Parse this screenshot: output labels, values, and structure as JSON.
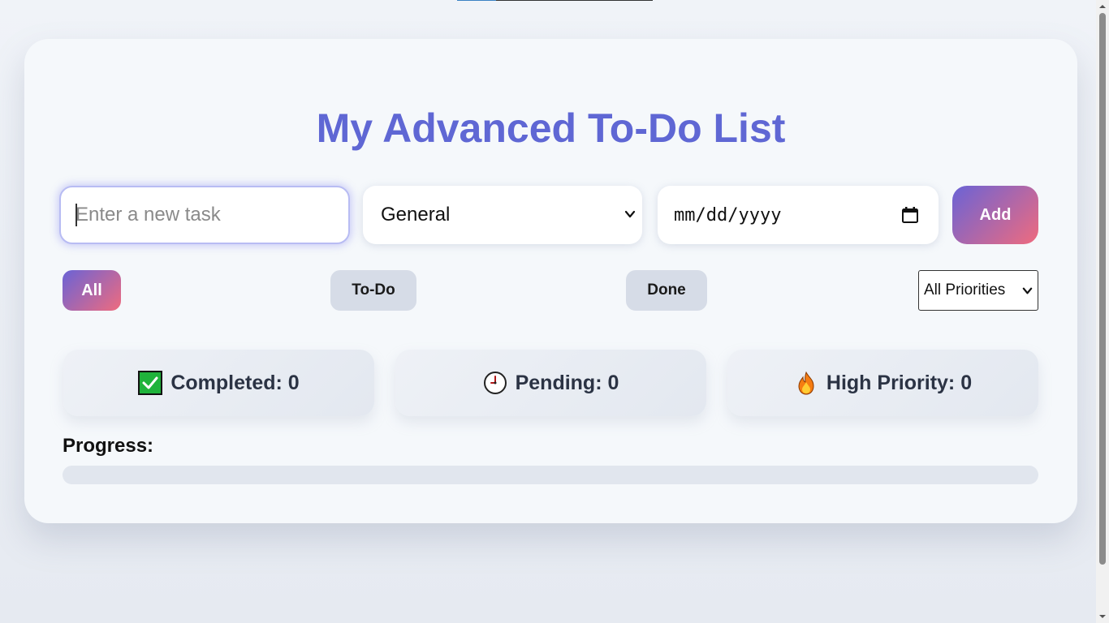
{
  "app": {
    "title": "My Advanced To-Do List"
  },
  "form": {
    "task_placeholder": "Enter a new task",
    "task_value": "",
    "category_value": "General",
    "date_placeholder": "mm/dd/yyyy",
    "add_label": "Add"
  },
  "filters": {
    "all_label": "All",
    "todo_label": "To-Do",
    "done_label": "Done",
    "active": "All",
    "priority_value": "All Priorities"
  },
  "stats": {
    "completed_label": "Completed: 0",
    "pending_label": "Pending: 0",
    "high_priority_label": "High Priority: 0"
  },
  "progress": {
    "label": "Progress:",
    "value_percent": 0
  },
  "colors": {
    "title": "#5f67d4",
    "gradient_start": "#6a63d6",
    "gradient_end": "#ef6b7e",
    "card_bg": "#f5f8fb"
  },
  "icons": {
    "completed": "check-box-icon",
    "pending": "clock-icon",
    "high_priority": "fire-icon"
  }
}
